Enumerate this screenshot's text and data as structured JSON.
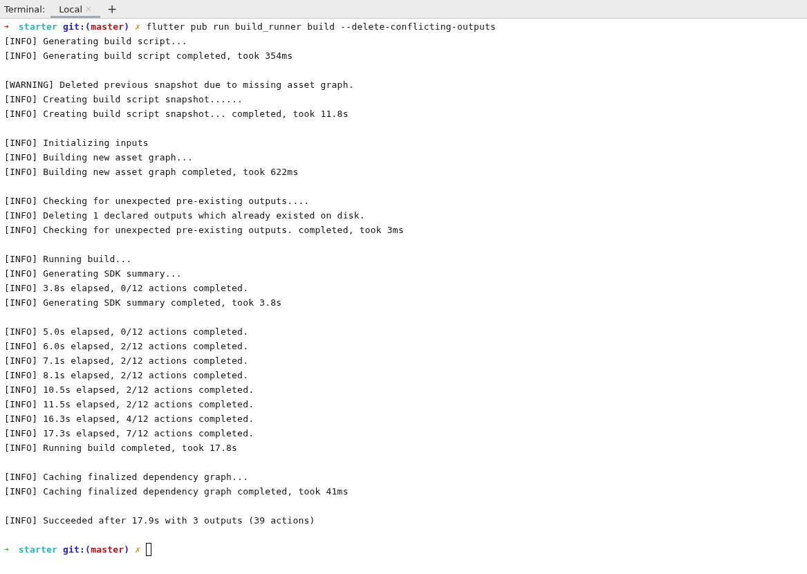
{
  "tool_window": {
    "title": "Terminal:",
    "tabs": [
      {
        "label": "Local",
        "selected": true,
        "close": "×"
      }
    ],
    "new_tab": "+"
  },
  "terminal": [
    {
      "kind": "prompt",
      "failed": true,
      "arrow": "➜",
      "directory": "starter",
      "git_prefix": "git:(",
      "branch": "master",
      "git_suffix": ")",
      "dirty_mark": "✗",
      "command": "flutter pub run build_runner build --delete-conflicting-outputs"
    },
    {
      "kind": "output",
      "lines": [
        "[INFO] Generating build script...",
        "[INFO] Generating build script completed, took 354ms"
      ]
    },
    {
      "kind": "output",
      "lines": [
        "[WARNING] Deleted previous snapshot due to missing asset graph.",
        "[INFO] Creating build script snapshot......",
        "[INFO] Creating build script snapshot... completed, took 11.8s"
      ]
    },
    {
      "kind": "output",
      "lines": [
        "[INFO] Initializing inputs",
        "[INFO] Building new asset graph...",
        "[INFO] Building new asset graph completed, took 622ms"
      ]
    },
    {
      "kind": "output",
      "lines": [
        "[INFO] Checking for unexpected pre-existing outputs....",
        "[INFO] Deleting 1 declared outputs which already existed on disk.",
        "[INFO] Checking for unexpected pre-existing outputs. completed, took 3ms"
      ]
    },
    {
      "kind": "output",
      "lines": [
        "[INFO] Running build...",
        "[INFO] Generating SDK summary...",
        "[INFO] 3.8s elapsed, 0/12 actions completed.",
        "[INFO] Generating SDK summary completed, took 3.8s"
      ]
    },
    {
      "kind": "output",
      "lines": [
        "[INFO] 5.0s elapsed, 0/12 actions completed.",
        "[INFO] 6.0s elapsed, 2/12 actions completed.",
        "[INFO] 7.1s elapsed, 2/12 actions completed.",
        "[INFO] 8.1s elapsed, 2/12 actions completed.",
        "[INFO] 10.5s elapsed, 2/12 actions completed.",
        "[INFO] 11.5s elapsed, 2/12 actions completed.",
        "[INFO] 16.3s elapsed, 4/12 actions completed.",
        "[INFO] 17.3s elapsed, 7/12 actions completed.",
        "[INFO] Running build completed, took 17.8s"
      ]
    },
    {
      "kind": "output",
      "lines": [
        "[INFO] Caching finalized dependency graph...",
        "[INFO] Caching finalized dependency graph completed, took 41ms"
      ]
    },
    {
      "kind": "output",
      "lines": [
        "[INFO] Succeeded after 17.9s with 3 outputs (39 actions)"
      ]
    },
    {
      "kind": "prompt",
      "failed": false,
      "arrow": "➜",
      "directory": "starter",
      "git_prefix": "git:(",
      "branch": "master",
      "git_suffix": ")",
      "dirty_mark": "✗",
      "cursor": true
    }
  ]
}
